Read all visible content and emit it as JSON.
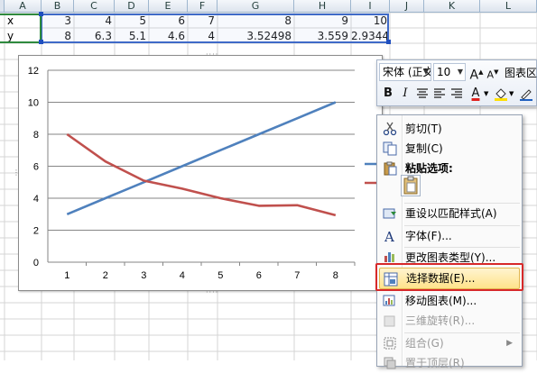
{
  "sheet": {
    "columns": [
      "A",
      "B",
      "C",
      "D",
      "E",
      "F",
      "G",
      "H",
      "I",
      "J",
      "K",
      "L"
    ],
    "row_x": {
      "label": "x",
      "values": [
        "3",
        "4",
        "5",
        "6",
        "7",
        "8",
        "9",
        "10"
      ]
    },
    "row_y": {
      "label": "y",
      "values": [
        "8",
        "6.3",
        "5.1",
        "4.6",
        "4",
        "3.52498",
        "3.559",
        "2.9344"
      ]
    }
  },
  "chart_data": {
    "type": "line",
    "title": "",
    "xlabel": "",
    "ylabel": "",
    "categories": [
      "1",
      "2",
      "3",
      "4",
      "5",
      "6",
      "7",
      "8"
    ],
    "series": [
      {
        "values": [
          3,
          4,
          5,
          6,
          7,
          8,
          9,
          10
        ],
        "color": "#4f81bd"
      },
      {
        "values": [
          8,
          6.3,
          5.1,
          4.6,
          4,
          3.52498,
          3.559,
          2.9344
        ],
        "color": "#c0504d"
      }
    ],
    "ylim": [
      0,
      12
    ],
    "yticks": [
      "0",
      "2",
      "4",
      "6",
      "8",
      "10",
      "12"
    ],
    "grid": true,
    "legend": "right"
  },
  "mini_toolbar": {
    "font_name": "宋体 (正文",
    "font_size": "10",
    "grow_font": "A",
    "shrink_font": "A",
    "chart_area": "图表区",
    "bold": "B",
    "italic": "I",
    "font_color_glyph": "A"
  },
  "context_menu": {
    "items": [
      {
        "label": "剪切(T)",
        "icon": "scissors-icon"
      },
      {
        "label": "复制(C)",
        "icon": "copy-icon"
      },
      {
        "label": "粘贴选项:",
        "icon": "paste-icon"
      },
      {
        "label": "重设以匹配样式(A)",
        "icon": "reset-style-icon"
      },
      {
        "label": "字体(F)...",
        "icon": "font-icon"
      },
      {
        "label": "更改图表类型(Y)...",
        "icon": "chart-type-icon"
      },
      {
        "label": "选择数据(E)...",
        "icon": "select-data-icon"
      },
      {
        "label": "移动图表(M)...",
        "icon": "move-chart-icon"
      },
      {
        "label": "三维旋转(R)...",
        "icon": "3d-rotate-icon"
      },
      {
        "label": "组合(G)",
        "icon": "group-icon"
      },
      {
        "label": "置于顶层(R)",
        "icon": "bring-front-icon"
      }
    ]
  },
  "colors": {
    "accent_blue": "#4f81bd",
    "accent_red": "#c0504d",
    "highlight_red": "#d7292a",
    "menu_hover": "#ffe38a"
  }
}
